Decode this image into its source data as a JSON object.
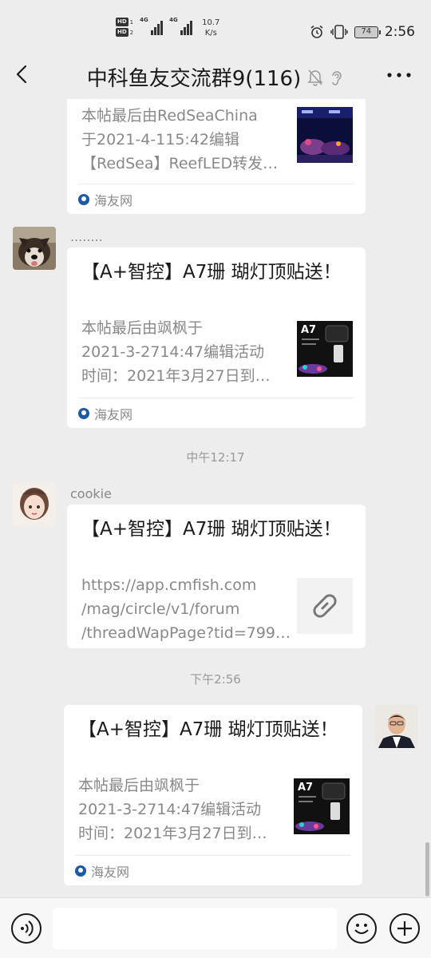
{
  "status_bar": {
    "hd1": "HD",
    "hd1_sub": "1",
    "hd2": "HD",
    "hd2_sub": "2",
    "sig1": "4G",
    "sig2": "4G",
    "speed_value": "10.7",
    "speed_unit": "K/s",
    "battery": "74",
    "time": "2:56"
  },
  "header": {
    "title": "中科鱼友交流群9(116)",
    "back_icon": "chevron-left-icon",
    "mute_icon": "bell-off-icon",
    "ear_icon": "ear-icon",
    "more_icon": "more-dots-icon"
  },
  "messages": [
    {
      "type": "card",
      "desc_lines": [
        "本帖最后由RedSeaChina",
        "于2021-4-115:42编辑",
        "【RedSea】ReefLED转发…"
      ],
      "source": "海友网",
      "thumb": "aquarium-photo"
    },
    {
      "type": "card",
      "nickname": "........",
      "title": "【A+智控】A7珊 瑚灯顶贴送！",
      "desc_lines": [
        "本帖最后由飒枫于",
        "2021-3-2714:47编辑活动",
        "时间：2021年3月27日到…"
      ],
      "source": "海友网",
      "thumb_label": "A7"
    },
    {
      "type": "timestamp",
      "text": "中午12:17"
    },
    {
      "type": "card",
      "nickname": "cookie",
      "title": "【A+智控】A7珊 瑚灯顶贴送！",
      "desc_lines": [
        "https://app.cmfish.com",
        "/mag/circle/v1/forum",
        "/threadWapPage?tid=799…"
      ],
      "thumb": "link-icon"
    },
    {
      "type": "timestamp",
      "text": "下午2:56"
    },
    {
      "type": "card",
      "self": true,
      "title": "【A+智控】A7珊 瑚灯顶贴送！",
      "desc_lines": [
        "本帖最后由飒枫于",
        "2021-3-2714:47编辑活动",
        "时间：2021年3月27日到…"
      ],
      "source": "海友网",
      "thumb_label": "A7"
    }
  ],
  "bottom_bar": {
    "voice_icon": "voice-icon",
    "input_value": "",
    "emoji_icon": "emoji-icon",
    "plus_icon": "plus-icon"
  },
  "colors": {
    "background": "#ededed",
    "card": "#ffffff",
    "muted_text": "#888888"
  }
}
